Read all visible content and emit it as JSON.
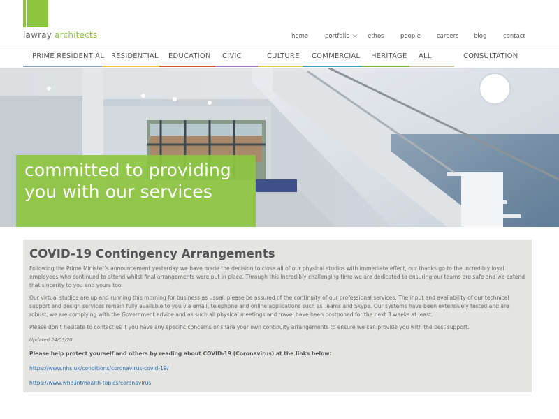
{
  "brand": {
    "name_part1": "lawray",
    "name_part2": "architects",
    "color": "#8cc63f"
  },
  "top_nav": [
    {
      "label": "home"
    },
    {
      "label": "portfolio",
      "icon": "chevron-down-icon"
    },
    {
      "label": "ethos"
    },
    {
      "label": "people"
    },
    {
      "label": "careers"
    },
    {
      "label": "blog"
    },
    {
      "label": "contact"
    }
  ],
  "categories": [
    {
      "label": "PRIME RESIDENTIAL",
      "color": "#8aa3b5"
    },
    {
      "label": "RESIDENTIAL",
      "color": "#e7c53a"
    },
    {
      "label": "EDUCATION",
      "color": "#c9553b"
    },
    {
      "label": "CIVIC",
      "color": "#9a7eb5"
    },
    {
      "label": "CULTURE",
      "color": "#d9cf3a"
    },
    {
      "label": "COMMERCIAL",
      "color": "#3aa6b3"
    },
    {
      "label": "HERITAGE",
      "color": "#7fb142"
    },
    {
      "label": "ALL",
      "color": "#c8bfa8"
    },
    {
      "label": "CONSULTATION",
      "color": ""
    }
  ],
  "hero": {
    "line1": "committed to providing",
    "line2": "you with our services"
  },
  "notice": {
    "title": "COVID-19 Contingency Arrangements",
    "p1": "Following the Prime Minister’s announcement yesterday we have made the decision to close all of our physical studios with immediate effect, our thanks go to the incredibly loyal employees who continued to attend whilst final arrangements were put in place. Through this incredibly challenging time we are dedicated to ensuring our teams are safe and we extend that sincerity to you and yours too.",
    "p2": "Our virtual studios are up and running this morning for business as usual, please be assured of the continuity of our professional services. The input and availability of our technical support and design services remain fully available to you via email, telephone and online applications such as Teams and Skype. Our systems have been extensively tested and are robust, we are complying with the Government advice and as such all physical meetings and travel have been postponed for the next 3 weeks at least.",
    "p3": "Please don’t hesitate to contact us if you have any specific concerns or share your own continuity arrangements to ensure we can provide you with the best support.",
    "updated": "Updated 24/03/20",
    "help": "Please help protect yourself and others by reading about COVID-19 (Coronavirus) at the links below:",
    "link1": "https://www.nhs.uk/conditions/coronavirus-covid-19/",
    "link2": "https://www.who.int/health-topics/coronavirus"
  }
}
